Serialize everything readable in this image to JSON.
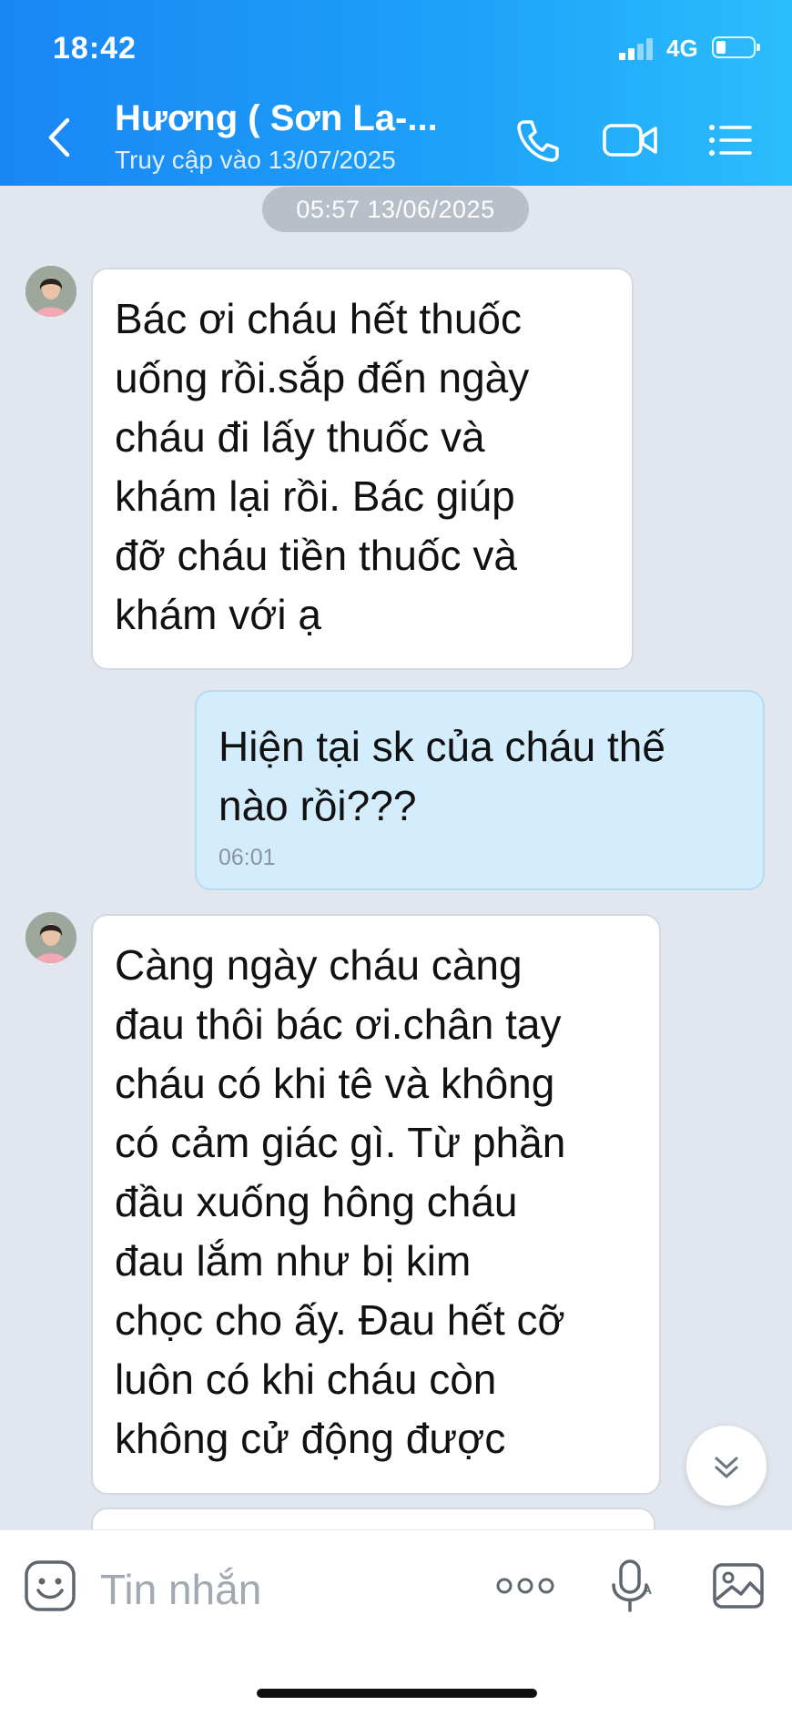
{
  "status_bar": {
    "time": "18:42",
    "network": "4G"
  },
  "header": {
    "title": "Hương ( Sơn La-...",
    "subtitle": "Truy cập vào 13/07/2025"
  },
  "chat": {
    "date_divider": "05:57 13/06/2025",
    "messages": [
      {
        "direction": "incoming",
        "text": "Bác ơi cháu hết thuốc\nuống rồi.sắp đến ngày\ncháu đi lấy thuốc và\nkhám lại rồi. Bác giúp\nđỡ cháu tiền thuốc và\nkhám với ạ"
      },
      {
        "direction": "outgoing",
        "text": "Hiện tại sk của cháu thế\nnào rồi???",
        "time": "06:01"
      },
      {
        "direction": "incoming",
        "text": "Càng ngày cháu càng\nđau thôi bác ơi.chân tay\ncháu có khi tê và không\ncó cảm giác gì. Từ phần\nđầu xuống hông cháu\nđau lắm như bị kim\nchọc cho ấy. Đau hết cỡ\nluôn có khi cháu còn\nkhông cử động được"
      }
    ]
  },
  "composer": {
    "placeholder": "Tin nhắn"
  },
  "colors": {
    "header_start": "#1a86f5",
    "header_end": "#2bbdfc",
    "chat_background": "#e2e6ee",
    "incoming_bubble": "#ffffff",
    "outgoing_bubble": "#d3edfd"
  },
  "icons": [
    "back-icon",
    "phone-icon",
    "video-call-icon",
    "menu-icon",
    "scroll-down-icon",
    "emoji-icon",
    "more-icon",
    "voice-icon",
    "image-icon"
  ]
}
